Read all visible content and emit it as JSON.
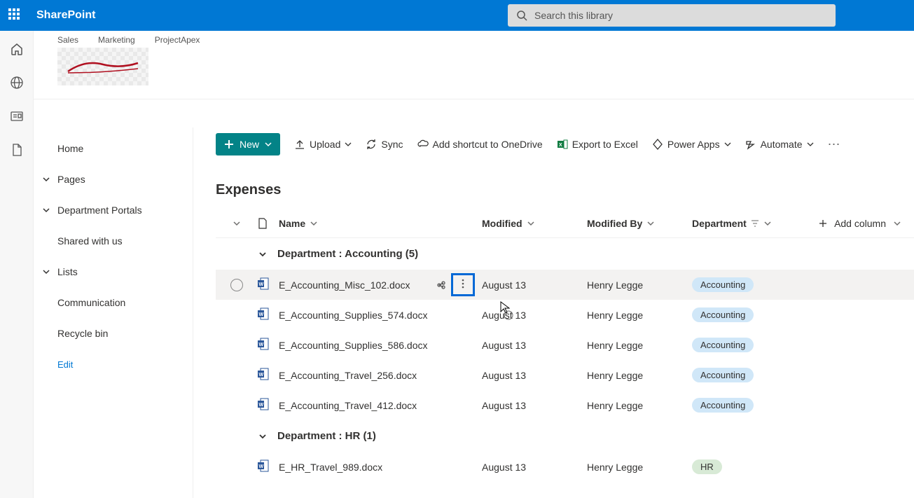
{
  "header": {
    "brand": "SharePoint",
    "search_placeholder": "Search this library"
  },
  "site_tabs": [
    "Sales",
    "Marketing",
    "ProjectApex"
  ],
  "left_nav": {
    "home": "Home",
    "pages": "Pages",
    "department_portals": "Department Portals",
    "shared": "Shared with us",
    "lists": "Lists",
    "communication": "Communication",
    "recycle": "Recycle bin",
    "edit": "Edit"
  },
  "toolbar": {
    "new": "New",
    "upload": "Upload",
    "sync": "Sync",
    "shortcut": "Add shortcut to OneDrive",
    "export": "Export to Excel",
    "powerapps": "Power Apps",
    "automate": "Automate"
  },
  "page_title": "Expenses",
  "columns": {
    "name": "Name",
    "modified": "Modified",
    "modified_by": "Modified By",
    "department": "Department",
    "add": "Add column"
  },
  "groups": [
    {
      "label": "Department : Accounting (5)",
      "rows": [
        {
          "name": "E_Accounting_Misc_102.docx",
          "modified": "August 13",
          "modified_by": "Henry Legge",
          "dept": "Accounting",
          "hovered": true
        },
        {
          "name": "E_Accounting_Supplies_574.docx",
          "modified": "August 13",
          "modified_by": "Henry Legge",
          "dept": "Accounting"
        },
        {
          "name": "E_Accounting_Supplies_586.docx",
          "modified": "August 13",
          "modified_by": "Henry Legge",
          "dept": "Accounting"
        },
        {
          "name": "E_Accounting_Travel_256.docx",
          "modified": "August 13",
          "modified_by": "Henry Legge",
          "dept": "Accounting"
        },
        {
          "name": "E_Accounting_Travel_412.docx",
          "modified": "August 13",
          "modified_by": "Henry Legge",
          "dept": "Accounting"
        }
      ]
    },
    {
      "label": "Department : HR (1)",
      "rows": [
        {
          "name": "E_HR_Travel_989.docx",
          "modified": "August 13",
          "modified_by": "Henry Legge",
          "dept": "HR"
        }
      ]
    }
  ]
}
